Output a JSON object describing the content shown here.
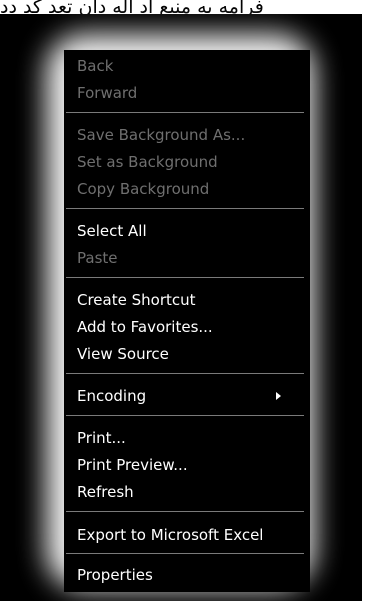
{
  "top_text": "فرامه به منبع اد اله دان تعد کد دد",
  "menu": {
    "items": [
      {
        "label": "Back",
        "enabled": false
      },
      {
        "label": "Forward",
        "enabled": false
      },
      {
        "label": "Save Background As...",
        "enabled": false
      },
      {
        "label": "Set as Background",
        "enabled": false
      },
      {
        "label": "Copy Background",
        "enabled": false
      },
      {
        "label": "Select All",
        "enabled": true
      },
      {
        "label": "Paste",
        "enabled": false
      },
      {
        "label": "Create Shortcut",
        "enabled": true
      },
      {
        "label": "Add to Favorites...",
        "enabled": true
      },
      {
        "label": "View Source",
        "enabled": true
      },
      {
        "label": "Encoding",
        "enabled": true,
        "submenu": true
      },
      {
        "label": "Print...",
        "enabled": true
      },
      {
        "label": "Print Preview...",
        "enabled": true
      },
      {
        "label": "Refresh",
        "enabled": true
      },
      {
        "label": "Export to Microsoft Excel",
        "enabled": true
      },
      {
        "label": "Properties",
        "enabled": true
      }
    ]
  }
}
